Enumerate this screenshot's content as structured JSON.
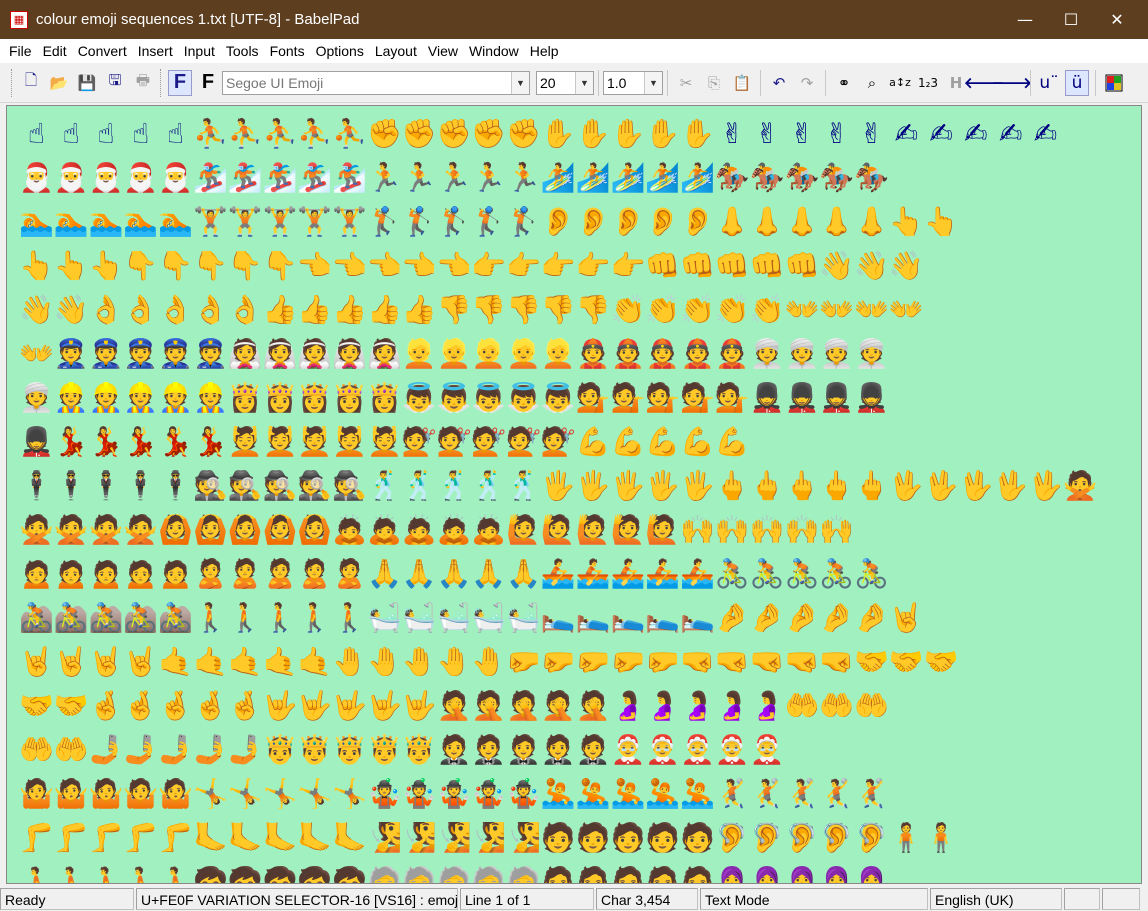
{
  "window": {
    "title": "colour emoji sequences 1.txt [UTF-8] - BabelPad"
  },
  "menu": [
    {
      "label": "File",
      "name": "menu-file"
    },
    {
      "label": "Edit",
      "name": "menu-edit"
    },
    {
      "label": "Convert",
      "name": "menu-convert"
    },
    {
      "label": "Insert",
      "name": "menu-insert"
    },
    {
      "label": "Input",
      "name": "menu-input"
    },
    {
      "label": "Tools",
      "name": "menu-tools"
    },
    {
      "label": "Fonts",
      "name": "menu-fonts"
    },
    {
      "label": "Options",
      "name": "menu-options"
    },
    {
      "label": "Layout",
      "name": "menu-layout"
    },
    {
      "label": "View",
      "name": "menu-view"
    },
    {
      "label": "Window",
      "name": "menu-window"
    },
    {
      "label": "Help",
      "name": "menu-help"
    }
  ],
  "toolbar": {
    "font_name": "Segoe UI Emoji",
    "font_size": "20",
    "line_spacing": "1.0",
    "buttons": {
      "font_bold_label": "F",
      "font_regular_label": "F",
      "units_label": "u¨",
      "umlaut_label": "ü",
      "az_label": "a↕z",
      "numbers_label": "1₂3",
      "h_label": "H"
    }
  },
  "content": {
    "rows": [
      "☝☝☝☝☝⛹⛹⛹⛹⛹✊✊✊✊✊✋✋✋✋✋✌✌✌✌✌✍✍✍✍✍",
      "🎅🎅🎅🎅🎅🏂🏂🏂🏂🏂🏃🏃🏃🏃🏃🏄🏄🏄🏄🏄🏇🏇🏇🏇🏇",
      "🏊🏊🏊🏊🏊🏋🏋🏋🏋🏋🏌🏌🏌🏌🏌👂👂👂👂👂👃👃👃👃👃👆👆",
      "👆👆👆👇👇👇👇👇👈👈👈👈👈👉👉👉👉👉👊👊👊👊👊👋👋👋",
      "👋👋👌👌👌👌👌👍👍👍👍👍👎👎👎👎👎👏👏👏👏👏👐👐👐👐",
      "👐👮👮👮👮👮👰👰👰👰👰👱👱👱👱👱👲👲👲👲👲👳👳👳👳",
      "👳👷👷👷👷👷👸👸👸👸👸👼👼👼👼👼💁💁💁💁💁💂💂💂💂",
      "💂💃💃💃💃💃💆💆💆💆💆💇💇💇💇💇💪💪💪💪💪",
      "🕴🕴🕴🕴🕴🕵🕵🕵🕵🕵🕺🕺🕺🕺🕺🖐🖐🖐🖐🖐🖕🖕🖕🖕🖕🖖🖖🖖🖖🖖🙅",
      "🙅🙅🙅🙅🙆🙆🙆🙆🙆🙇🙇🙇🙇🙇🙋🙋🙋🙋🙋🙌🙌🙌🙌🙌",
      "🙍🙍🙍🙍🙍🙎🙎🙎🙎🙎🙏🙏🙏🙏🙏🚣🚣🚣🚣🚣🚴🚴🚴🚴🚴",
      "🚵🚵🚵🚵🚵🚶🚶🚶🚶🚶🛀🛀🛀🛀🛀🛌🛌🛌🛌🛌🤌🤌🤌🤌🤌🤘",
      "🤘🤘🤘🤘🤙🤙🤙🤙🤙🤚🤚🤚🤚🤚🤛🤛🤛🤛🤛🤜🤜🤜🤜🤜🤝🤝🤝",
      "🤝🤝🤞🤞🤞🤞🤞🤟🤟🤟🤟🤟🤦🤦🤦🤦🤦🤰🤰🤰🤰🤰🤲🤲🤲",
      "🤲🤲🤳🤳🤳🤳🤳🤴🤴🤴🤴🤴🤵🤵🤵🤵🤵🤶🤶🤶🤶🤶",
      "🤷🤷🤷🤷🤷🤸🤸🤸🤸🤸🤹🤹🤹🤹🤹🤽🤽🤽🤽🤽🤾🤾🤾🤾🤾",
      "🦵🦵🦵🦵🦵🦶🦶🦶🦶🦶🧏🧏🧏🧏🧏🧑🧑🧑🧑🧑🦻🦻🦻🦻🦻🧍🧍",
      "🧎🧎🧎🧎🧎🧒🧒🧒🧒🧒🧓🧓🧓🧓🧓🧔🧔🧔🧔🧔🧕🧕🧕🧕🧕"
    ]
  },
  "status": {
    "ready": "Ready",
    "char_info": "U+FE0F VARIATION SELECTOR-16 [VS16] : emoji",
    "line": "Line 1 of 1",
    "char": "Char 3,454",
    "mode": "Text Mode",
    "language": "English (UK)",
    "extra1": "",
    "extra2": ""
  }
}
